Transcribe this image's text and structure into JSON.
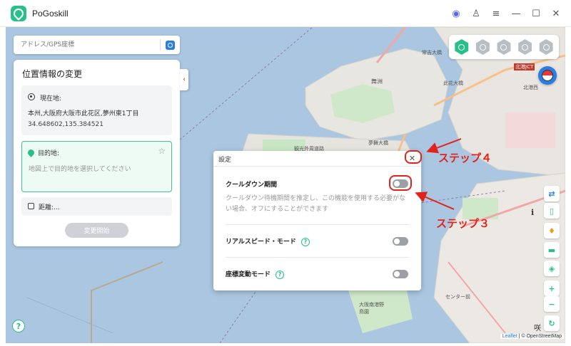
{
  "app": {
    "title": "PoGoskill"
  },
  "titlebar_icons": [
    {
      "name": "discord-icon",
      "glyph": "◉"
    },
    {
      "name": "user-icon",
      "glyph": "♙"
    },
    {
      "name": "menu-icon",
      "glyph": "≡"
    },
    {
      "name": "minimize-icon",
      "glyph": "—"
    },
    {
      "name": "maximize-icon",
      "glyph": "☐"
    },
    {
      "name": "close-icon",
      "glyph": "✕"
    }
  ],
  "search": {
    "placeholder": "アドレス/GPS座標"
  },
  "panel": {
    "title": "位置情報の変更",
    "current": {
      "label": "現在地:",
      "address": "本州,大阪府大阪市此花区,夢州東1丁目",
      "coords": "34.648602,135.384521"
    },
    "destination": {
      "label": "目的地:",
      "placeholder": "地図上で目的地を選択してください"
    },
    "distance": {
      "label": "距離:..."
    },
    "change_button": "変更開始"
  },
  "map_labels": {
    "l1": "常吉大橋",
    "l2": "舞洲",
    "l3": "此花大橋",
    "l4": "夢舞大橋",
    "l5": "観光外周道路",
    "l6": "センター前",
    "l7": "大阪南港野鳥園",
    "l8": "北港JCT",
    "l9": "北港西",
    "l10": "咲"
  },
  "dialog": {
    "title": "設定",
    "cooldown": {
      "title": "クールダウン期間",
      "desc": "クールダウン待機期間を推定し、この機能を使用する必要がない場合、オフにすることができます",
      "enabled": false
    },
    "realspeed": {
      "title": "リアルスピード・モード",
      "enabled": false
    },
    "coordshift": {
      "title": "座標変動モード",
      "enabled": false
    },
    "help_glyph": "?"
  },
  "annotations": {
    "step4": "ステップ４",
    "step3": "ステップ３"
  },
  "attribution": {
    "leaflet": "Leaflet",
    "rest": " | © OpenStreetMap"
  },
  "help": "?",
  "info": "i",
  "colors": {
    "accent": "#27c08a",
    "annotation": "#e0241b",
    "water": "#aac6e0"
  }
}
